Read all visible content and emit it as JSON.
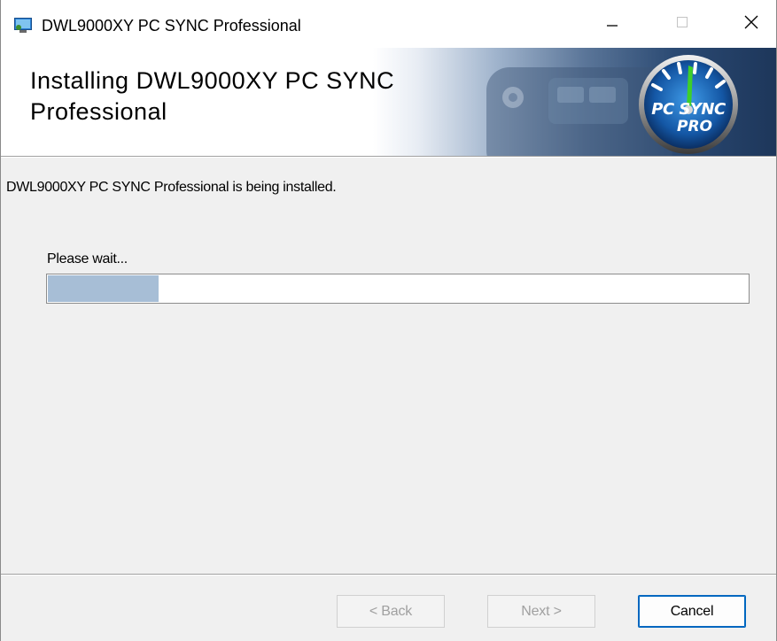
{
  "window": {
    "title": "DWL9000XY PC SYNC Professional",
    "icons": {
      "app": "installer-app-icon",
      "minimize": "minimize-icon",
      "maximize": "maximize-icon",
      "close": "close-icon"
    }
  },
  "banner": {
    "title": "Installing DWL9000XY PC SYNC Professional",
    "logo": {
      "line1": "PC SYNC",
      "line2": "PRO"
    },
    "colors": {
      "gradient_start": "#ffffff",
      "gradient_end": "#1d365a",
      "logo_accent": "#2f7fd0"
    }
  },
  "main": {
    "status_text": "DWL9000XY PC SYNC Professional is being installed.",
    "progress_label": "Please wait...",
    "progress": {
      "fraction": 0.16,
      "fill_color": "#a7bed6"
    }
  },
  "footer": {
    "back_label": "< Back",
    "next_label": "Next >",
    "cancel_label": "Cancel"
  }
}
